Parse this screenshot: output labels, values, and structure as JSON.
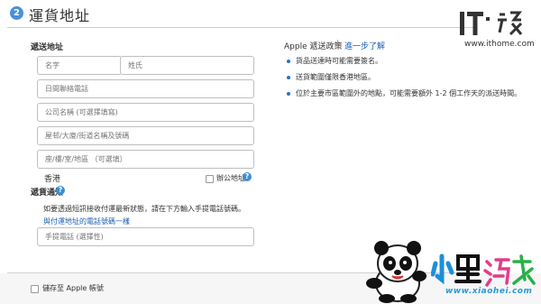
{
  "header": {
    "step_number": "2",
    "title": "運貨地址"
  },
  "watermark": {
    "logo_text": "IT之家",
    "url": "www.ithome.com"
  },
  "address_section": {
    "label": "遞送地址",
    "first_name_placeholder": "名字",
    "last_name_placeholder": "姓氏",
    "phone_placeholder": "日間聯絡電話",
    "company_placeholder": "公司名稱 (可選擇填寫)",
    "street_placeholder": "屋邨/大廈/街道名稱及號碼",
    "floor_placeholder": "座/樓/室/地區 （可選填）",
    "country": "香港",
    "office_address_label": "辦公地址"
  },
  "notify_section": {
    "label": "遞貨通知",
    "description": "如要透過短訊接收付運最新狀態，請在下方輸入手提電話號碼。",
    "same_phone_link": "與付運地址的電話號碼一樣",
    "mobile_placeholder": "手提電話 (選擇性)"
  },
  "policy": {
    "title": "Apple 遞送政策",
    "separator": "|",
    "learn_more": "進一步了解",
    "bullets": [
      "貨品送達時可能需要簽名。",
      "送貨範圍僅限香港地區。",
      "位於主要市區範圍外的地點，可能需要額外 1-2 個工作天的派送時間。"
    ]
  },
  "footer": {
    "save_to_apple_id_label": "儲存至 Apple 帳號"
  },
  "brand": {
    "name": "小黑游戏",
    "url": "www.xiaohei.com"
  },
  "colors": {
    "accent_blue": "#3b8ed6",
    "link_blue": "#1a5fb4",
    "border_gray": "#bfbfbf"
  }
}
